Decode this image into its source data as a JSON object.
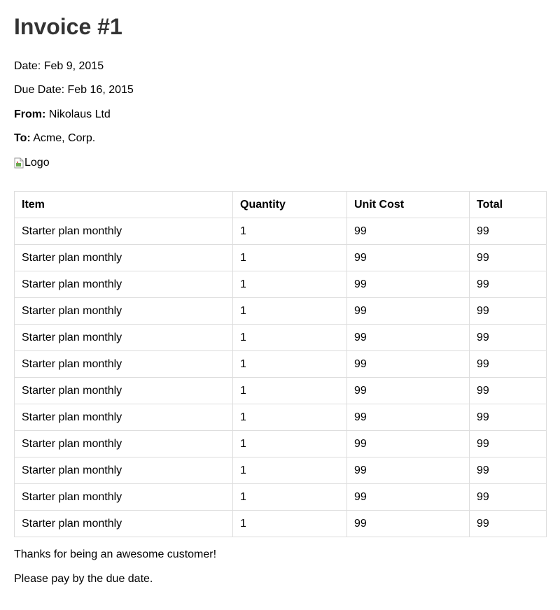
{
  "invoice": {
    "title": "Invoice #1",
    "date_label": "Date:",
    "date": "Feb 9, 2015",
    "due_label": "Due Date:",
    "due_date": "Feb 16, 2015",
    "from_label": "From:",
    "from": "Nikolaus Ltd",
    "to_label": "To:",
    "to": "Acme, Corp.",
    "logo_alt": "Logo",
    "logo_icon": "broken-image-icon"
  },
  "table": {
    "headers": [
      "Item",
      "Quantity",
      "Unit Cost",
      "Total"
    ],
    "rows": [
      [
        "Starter plan monthly",
        "1",
        "99",
        "99"
      ],
      [
        "Starter plan monthly",
        "1",
        "99",
        "99"
      ],
      [
        "Starter plan monthly",
        "1",
        "99",
        "99"
      ],
      [
        "Starter plan monthly",
        "1",
        "99",
        "99"
      ],
      [
        "Starter plan monthly",
        "1",
        "99",
        "99"
      ],
      [
        "Starter plan monthly",
        "1",
        "99",
        "99"
      ],
      [
        "Starter plan monthly",
        "1",
        "99",
        "99"
      ],
      [
        "Starter plan monthly",
        "1",
        "99",
        "99"
      ],
      [
        "Starter plan monthly",
        "1",
        "99",
        "99"
      ],
      [
        "Starter plan monthly",
        "1",
        "99",
        "99"
      ],
      [
        "Starter plan monthly",
        "1",
        "99",
        "99"
      ],
      [
        "Starter plan monthly",
        "1",
        "99",
        "99"
      ]
    ]
  },
  "footer": {
    "thanks": "Thanks for being an awesome customer!",
    "pay_note": "Please pay by the due date."
  },
  "colors": {
    "title": "#333333",
    "border": "#dddddd",
    "text": "#000000"
  }
}
